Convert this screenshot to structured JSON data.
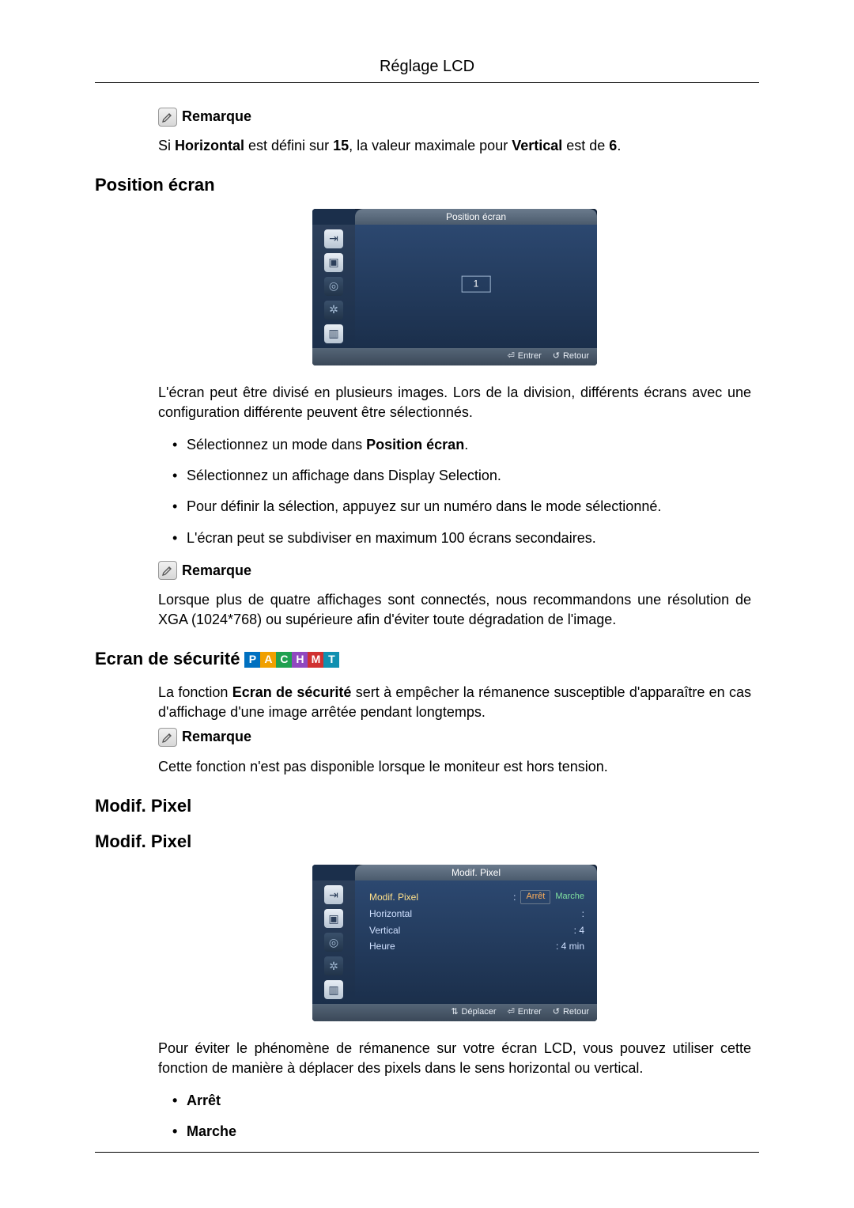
{
  "page": {
    "header": "Réglage LCD"
  },
  "sec1": {
    "note_label": "Remarque",
    "note_text_pre": "Si ",
    "note_text_b1": "Horizontal",
    "note_text_mid": " est défini sur ",
    "note_text_b2": "15",
    "note_text_mid2": ", la valeur maximale pour ",
    "note_text_b3": "Vertical",
    "note_text_mid3": " est de ",
    "note_text_b4": "6",
    "note_text_end": "."
  },
  "sec2": {
    "title": "Position écran",
    "osd_title": "Position écran",
    "osd_value": "1",
    "osd_enter": "Entrer",
    "osd_return": "Retour",
    "desc": "L'écran peut être divisé en plusieurs images. Lors de la division, différents écrans avec une configuration différente peuvent être sélectionnés.",
    "b1a": "Sélectionnez un mode dans ",
    "b1b": "Position écran",
    "b1c": ".",
    "b2": "Sélectionnez un affichage dans Display Selection.",
    "b3": "Pour définir la sélection, appuyez sur un numéro dans le mode sélectionné.",
    "b4": "L'écran peut se subdiviser en maximum 100 écrans secondaires.",
    "note_label": "Remarque",
    "note_text": "Lorsque plus de quatre affichages sont connectés, nous recommandons une résolution de XGA (1024*768) ou supérieure afin d'éviter toute dégradation de l'image."
  },
  "sec3": {
    "title": "Ecran de sécurité",
    "badges": [
      "P",
      "A",
      "C",
      "H",
      "M",
      "T"
    ],
    "desc_a": "La fonction ",
    "desc_b": "Ecran de sécurité",
    "desc_c": " sert à empêcher la rémanence susceptible d'apparaître en cas d'affichage d'une image arrêtée pendant longtemps.",
    "note_label": "Remarque",
    "note_text": "Cette fonction n'est pas disponible lorsque le moniteur est hors tension."
  },
  "sec4": {
    "title1": "Modif. Pixel",
    "title2": "Modif. Pixel",
    "osd_title": "Modif. Pixel",
    "row1_label": "Modif. Pixel",
    "row1_val": "Arrêt",
    "row1_opt": "Marche",
    "row2_label": "Horizontal",
    "row2_val": "",
    "row3_label": "Vertical",
    "row3_val": "4",
    "row4_label": "Heure",
    "row4_val": "4 min",
    "osd_move": "Déplacer",
    "osd_enter": "Entrer",
    "osd_return": "Retour",
    "desc": "Pour éviter le phénomène de rémanence sur votre écran LCD, vous pouvez utiliser cette fonction de manière à déplacer des pixels dans le sens horizontal ou vertical.",
    "opt1": "Arrêt",
    "opt2": "Marche"
  }
}
